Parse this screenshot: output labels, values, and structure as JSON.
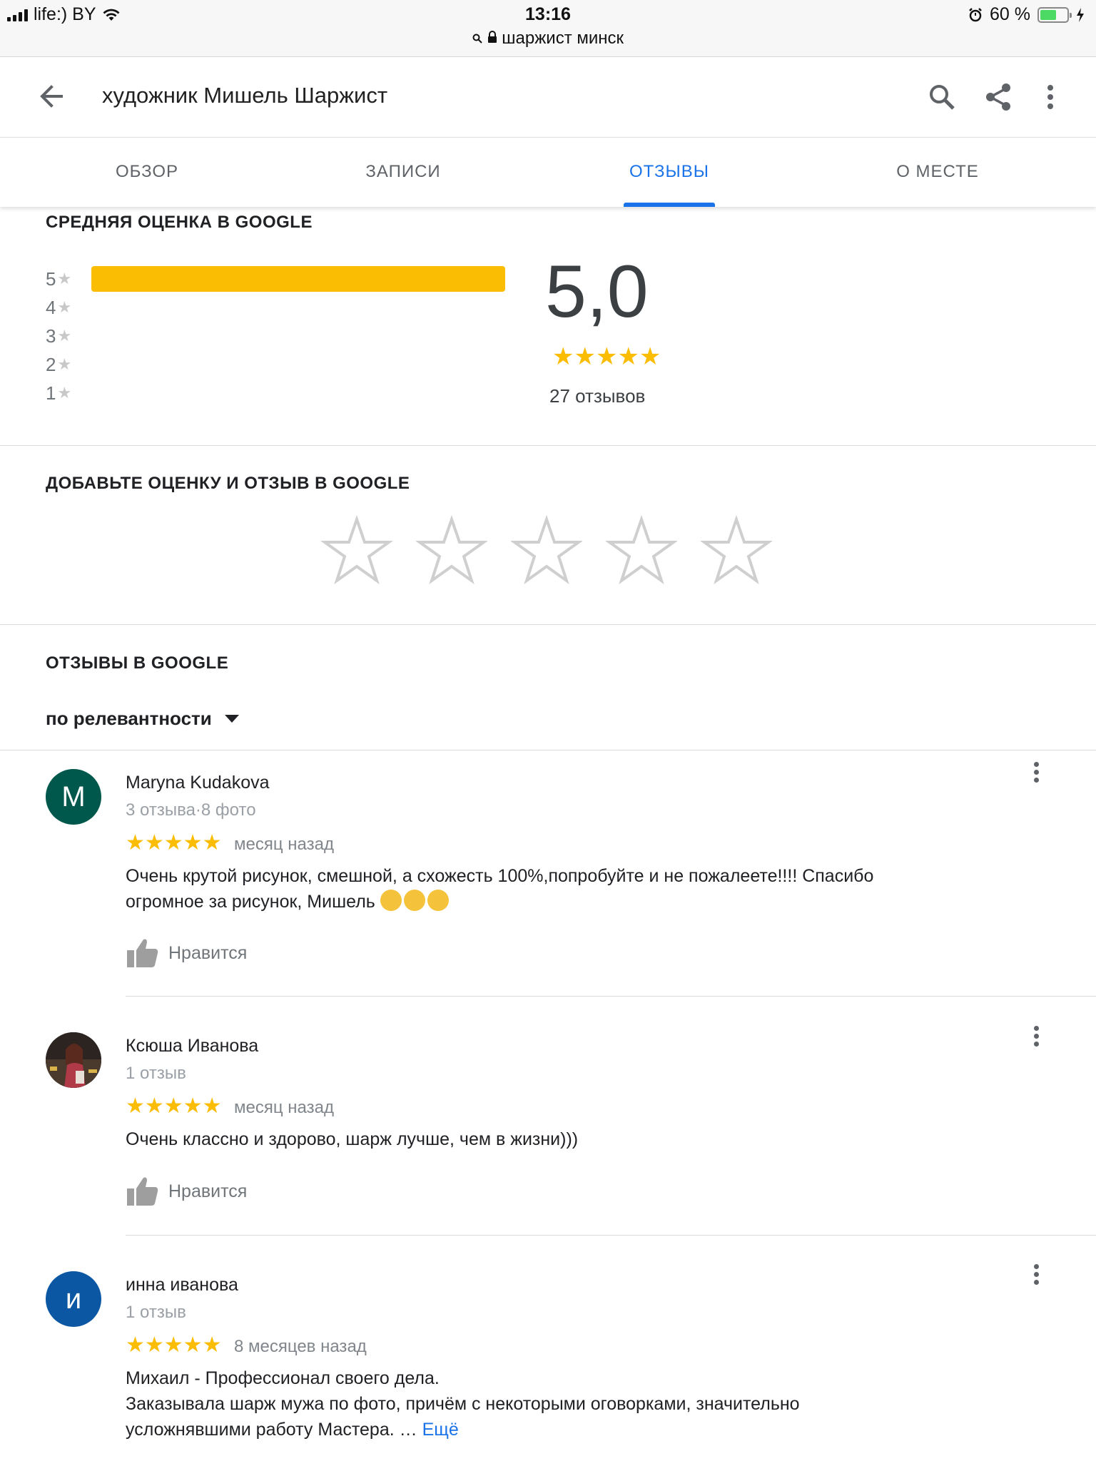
{
  "status_bar": {
    "carrier": "life:) BY",
    "time": "13:16",
    "url": "шаржист минск",
    "battery": "60 %",
    "battery_level": 0.6
  },
  "header": {
    "title": "художник Мишель Шаржист"
  },
  "tabs": [
    {
      "label": "ОБЗОР",
      "active": false
    },
    {
      "label": "ЗАПИСИ",
      "active": false
    },
    {
      "label": "ОТЗЫВЫ",
      "active": true
    },
    {
      "label": "О МЕСТЕ",
      "active": false
    }
  ],
  "summary": {
    "heading": "СРЕДНЯЯ ОЦЕНКА В GOOGLE",
    "histogram": [
      {
        "stars": "5",
        "fraction": 1.0
      },
      {
        "stars": "4",
        "fraction": 0
      },
      {
        "stars": "3",
        "fraction": 0
      },
      {
        "stars": "2",
        "fraction": 0
      },
      {
        "stars": "1",
        "fraction": 0
      }
    ],
    "rating": "5,0",
    "stars": "★★★★★",
    "count": "27 отзывов"
  },
  "add_review": {
    "heading": "ДОБАВЬТЕ ОЦЕНКУ И ОТЗЫВ В GOOGLE"
  },
  "reviews_section": {
    "heading": "ОТЗЫВЫ В GOOGLE",
    "sort_label": "по релевантности"
  },
  "reviews": [
    {
      "name": "Maryna Kudakova",
      "avatar_letter": "M",
      "avatar_color": "#00574b",
      "meta": "3 отзыва·8 фото",
      "stars": "★★★★★",
      "date": "месяц назад",
      "text_line1": "Очень крутой рисунок, смешной, а схожесть 100%,попробуйте и не пожалеете!!!! Спасибо",
      "text_line2": "огромное за рисунок, Мишель",
      "like_label": "Нравится"
    },
    {
      "name": "Ксюша Иванова",
      "avatar_letter": "",
      "avatar_color": "#6b5a4e",
      "meta": "1 отзыв",
      "stars": "★★★★★",
      "date": "месяц назад",
      "text_line1": "Очень классно и здорово, шарж лучше, чем в жизни)))",
      "like_label": "Нравится"
    },
    {
      "name": "инна иванова",
      "avatar_letter": "и",
      "avatar_color": "#0b57a4",
      "meta": "1 отзыв",
      "stars": "★★★★★",
      "date": "8 месяцев назад",
      "text_line1": "Михаил - Профессионал своего дела.",
      "text_line2": "Заказывала шарж мужа по фото, причём с некоторыми оговорками, значительно",
      "text_line3": "усложнявшими работу Мастера. …",
      "more_label": "Ещё"
    }
  ],
  "icons": {
    "back": "arrow-left-icon",
    "search": "search-icon",
    "share": "share-icon",
    "menu": "more-vert-icon",
    "like": "thumbs-up-icon",
    "empty_star": "star-outline-icon"
  },
  "colors": {
    "accent": "#1a73e8",
    "star": "#fbbc04"
  }
}
